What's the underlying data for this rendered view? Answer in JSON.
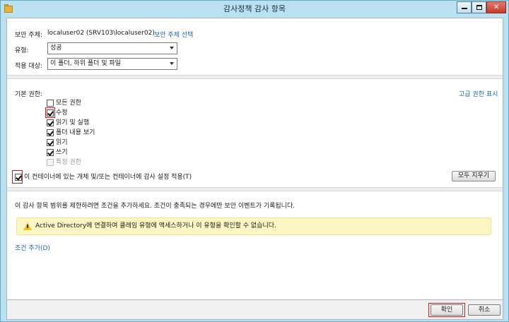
{
  "window": {
    "title": "감사정책 감사 항목"
  },
  "principal": {
    "label": "보안 주체:",
    "value": "localuser02 (SRV103\\localuser02)",
    "select_link": "보안 주체 선택"
  },
  "type": {
    "label": "유형:",
    "selected": "성공"
  },
  "applies_to": {
    "label": "적용 대상:",
    "selected": "이 폴더, 하위 폴더 및 파일"
  },
  "permissions": {
    "label": "기본 권한:",
    "advanced_link": "고급 권한 표시",
    "items": [
      {
        "label": "모든 권한",
        "checked": false,
        "disabled": false
      },
      {
        "label": "수정",
        "checked": true,
        "disabled": false
      },
      {
        "label": "읽기 및 실행",
        "checked": true,
        "disabled": false
      },
      {
        "label": "폴더 내용 보기",
        "checked": true,
        "disabled": false
      },
      {
        "label": "읽기",
        "checked": true,
        "disabled": false
      },
      {
        "label": "쓰기",
        "checked": true,
        "disabled": false
      },
      {
        "label": "특정 권한",
        "checked": false,
        "disabled": true
      }
    ],
    "apply_within_label": "이 컨테이너에 있는 개체 및/또는 컨테이너에 감사 설정 적용(T)",
    "apply_within_checked": true,
    "clear_all_label": "모두 지우기"
  },
  "conditions": {
    "description": "이 감사 항목 범위를 제한하려면 조건을 추가하세요. 조건이 충족되는 경우에만 보안 이벤트가 기록됩니다.",
    "warning": "Active Directory에 연결하여 클레임 유형에 액세스하거나 이 유형을 확인할 수 없습니다.",
    "add_condition_link": "조건 추가(D)"
  },
  "footer": {
    "ok_label": "확인",
    "cancel_label": "취소"
  },
  "colors": {
    "link": "#1a66b8",
    "highlight_box": "#d21a1a",
    "warning_bg": "#fbf6c3",
    "title_bar": "#b9e1f2"
  }
}
